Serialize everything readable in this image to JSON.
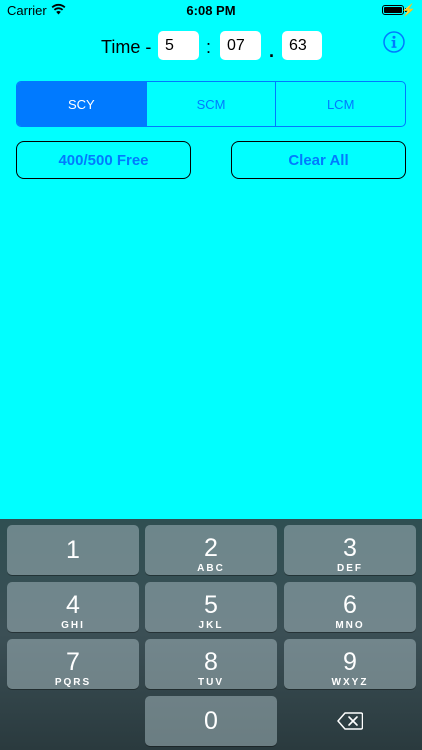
{
  "status_bar": {
    "carrier": "Carrier",
    "time": "6:08 PM"
  },
  "time_entry": {
    "label": "Time -",
    "minutes": "5",
    "seconds": "07",
    "hundredths": "63",
    "colon": ":",
    "dot": "."
  },
  "segments": [
    {
      "label": "SCY",
      "selected": true
    },
    {
      "label": "SCM",
      "selected": false
    },
    {
      "label": "LCM",
      "selected": false
    }
  ],
  "buttons": {
    "free_count": "400/500 Free",
    "clear_all": "Clear All"
  },
  "keypad": {
    "keys": [
      {
        "num": "1",
        "letters": ""
      },
      {
        "num": "2",
        "letters": "ABC"
      },
      {
        "num": "3",
        "letters": "DEF"
      },
      {
        "num": "4",
        "letters": "GHI"
      },
      {
        "num": "5",
        "letters": "JKL"
      },
      {
        "num": "6",
        "letters": "MNO"
      },
      {
        "num": "7",
        "letters": "PQRS"
      },
      {
        "num": "8",
        "letters": "TUV"
      },
      {
        "num": "9",
        "letters": "WXYZ"
      },
      {
        "num": "0",
        "letters": ""
      }
    ],
    "delete_icon": "backspace-icon"
  },
  "colors": {
    "background": "#00FFFF",
    "accent": "#007AFF"
  }
}
